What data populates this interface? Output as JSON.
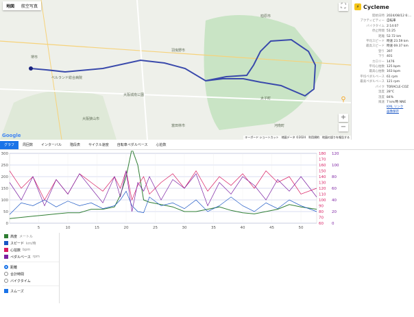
{
  "map": {
    "type_controls": [
      "地図",
      "航空写真"
    ],
    "labels": [
      "堺市",
      "ベルランド総合病院",
      "大阪狭山市",
      "富田林市",
      "羽曳野市",
      "柏原市",
      "大阪城南公園",
      "太子町",
      "河南町",
      "富田林市"
    ],
    "attribution": [
      "キーボード ショートカット",
      "地図データ ©2024",
      "利用規約",
      "地図の誤りを報告する"
    ],
    "google": "Google",
    "zoom_in": "+",
    "zoom_out": "−"
  },
  "panel": {
    "title": "Cycleme",
    "stats": [
      {
        "k": "開始日時",
        "v": "2024/08/12 6:…"
      },
      {
        "k": "アクティビティー",
        "v": "自転車"
      },
      {
        "k": "バイクタイム",
        "v": "2:14:07"
      },
      {
        "k": "停止時間",
        "v": "51:25"
      },
      {
        "k": "距離",
        "v": "52.72 km"
      },
      {
        "k": "平均スピード",
        "v": "時速 23.59 km"
      },
      {
        "k": "最高スピード",
        "v": "時速 69.37 km"
      },
      {
        "k": "登り",
        "v": "397"
      },
      {
        "k": "下り",
        "v": "401"
      },
      {
        "k": "カロリー",
        "v": "1476"
      },
      {
        "k": "平均心拍数",
        "v": "125 bpm"
      },
      {
        "k": "最高心拍数",
        "v": "163 bpm"
      },
      {
        "k": "平均ペダルベース",
        "v": "61 rpm"
      },
      {
        "k": "最高ペダルベース",
        "v": "121 rpm"
      },
      {
        "k": "バイク",
        "v": "TORACLE-COZ"
      },
      {
        "k": "温度",
        "v": "28°C"
      },
      {
        "k": "湿度",
        "v": "84%"
      },
      {
        "k": "風速",
        "v": "7 km/時 NNE"
      }
    ],
    "links": [
      "KML リンク",
      "画像保存"
    ]
  },
  "tabs": [
    "グラフ",
    "周回数",
    "インターバル",
    "階段表",
    "サイクル速度",
    "自転車ペダルベース",
    "心拍数"
  ],
  "legend": {
    "series": [
      {
        "label": "高度",
        "unit": "メートル",
        "color": "#2e7d32"
      },
      {
        "label": "スピード",
        "unit": "km/時",
        "color": "#1a56c4"
      },
      {
        "label": "心拍数",
        "unit": "bpm",
        "color": "#d81b60"
      },
      {
        "label": "ペダルベース",
        "unit": "rpm",
        "color": "#7b1fa2"
      }
    ],
    "axis_options": [
      "距離",
      "合計時間",
      "バイクタイム"
    ],
    "smooth": "スムーズ"
  },
  "chart_data": {
    "type": "line",
    "x": [
      0,
      2,
      4,
      6,
      8,
      10,
      12,
      14,
      16,
      18,
      19,
      20,
      21,
      22,
      23,
      24,
      26,
      28,
      30,
      32,
      34,
      36,
      38,
      40,
      42,
      44,
      46,
      48,
      50,
      52.7
    ],
    "xticks": [
      5,
      10,
      15,
      20,
      25,
      30,
      35,
      40,
      45,
      50
    ],
    "xlim": [
      0,
      52.7
    ],
    "y_left_ticks": [
      0,
      50,
      100,
      150,
      200,
      250,
      300
    ],
    "y_left_lim": [
      0,
      300
    ],
    "y_right1_ticks": [
      60,
      70,
      80,
      90,
      100,
      110,
      120,
      130,
      140,
      150,
      160,
      170,
      180
    ],
    "y_right1_lim": [
      60,
      180
    ],
    "y_right2_ticks": [
      0,
      20,
      40,
      60,
      80,
      100,
      120
    ],
    "y_right2_lim": [
      0,
      120
    ],
    "series": [
      {
        "name": "高度",
        "axis": "left",
        "values": [
          20,
          25,
          30,
          35,
          40,
          45,
          45,
          60,
          60,
          70,
          120,
          200,
          320,
          250,
          100,
          90,
          80,
          70,
          50,
          50,
          60,
          70,
          55,
          45,
          40,
          50,
          60,
          80,
          70,
          60
        ]
      },
      {
        "name": "スピード",
        "axis": "right2",
        "values": [
          15,
          35,
          30,
          40,
          28,
          38,
          30,
          35,
          25,
          30,
          40,
          55,
          30,
          20,
          18,
          45,
          30,
          35,
          25,
          40,
          20,
          30,
          45,
          30,
          20,
          35,
          25,
          40,
          30,
          20
        ]
      },
      {
        "name": "心拍数",
        "axis": "right1",
        "values": [
          150,
          120,
          140,
          100,
          135,
          110,
          145,
          130,
          115,
          140,
          120,
          150,
          100,
          125,
          140,
          110,
          130,
          145,
          120,
          150,
          115,
          140,
          125,
          145,
          120,
          150,
          130,
          140,
          110,
          120
        ]
      },
      {
        "name": "ペダルベース",
        "axis": "right2",
        "values": [
          70,
          40,
          80,
          30,
          75,
          50,
          85,
          60,
          35,
          80,
          45,
          90,
          20,
          70,
          55,
          80,
          40,
          75,
          60,
          85,
          30,
          70,
          50,
          80,
          65,
          40,
          75,
          55,
          80,
          45
        ]
      }
    ]
  }
}
